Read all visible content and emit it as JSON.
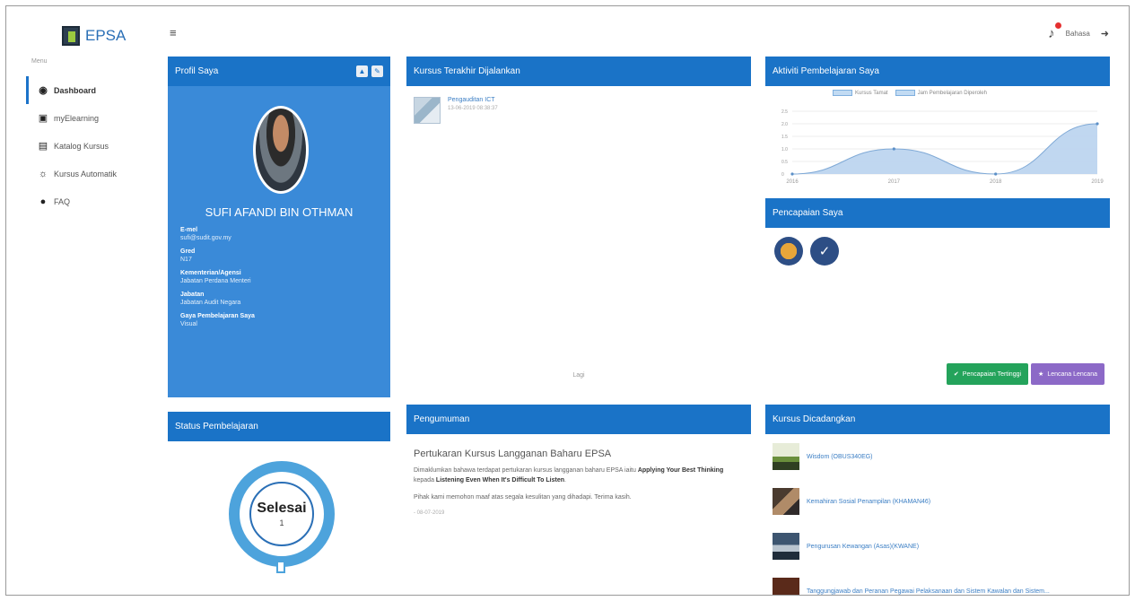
{
  "brand": {
    "name": "EPSA"
  },
  "sidebar": {
    "caption": "Menu",
    "items": [
      {
        "label": "Dashboard",
        "icon": "dashboard-icon",
        "active": true
      },
      {
        "label": "myElearning",
        "icon": "square-icon"
      },
      {
        "label": "Katalog Kursus",
        "icon": "book-icon"
      },
      {
        "label": "Kursus Automatik",
        "icon": "bulb-icon"
      },
      {
        "label": "FAQ",
        "icon": "circle-icon"
      }
    ]
  },
  "topbar": {
    "language_label": "Bahasa",
    "notification_icon": "bell-icon",
    "logout_icon": "signout-icon"
  },
  "profile": {
    "title": "Profil Saya",
    "name": "SUFI AFANDI BIN OTHMAN",
    "fields": [
      {
        "key": "E-mel",
        "value": "sufi@sudit.gov.my"
      },
      {
        "key": "Gred",
        "value": "N17"
      },
      {
        "key": "Kementerian/Agensi",
        "value": "Jabatan Perdana Menteri"
      },
      {
        "key": "Jabatan",
        "value": "Jabatan Audit Negara"
      },
      {
        "key": "Gaya Pembelajaran Saya",
        "value": "Visual"
      }
    ]
  },
  "status": {
    "title": "Status Pembelajaran",
    "label": "Selesai",
    "count": "1"
  },
  "recent": {
    "title": "Kursus Terakhir Dijalankan",
    "course_title": "Pengauditan ICT",
    "course_date": "13-06-2019 08:38:37",
    "more": "Lagi"
  },
  "announcement": {
    "title": "Pengumuman",
    "heading": "Pertukaran Kursus Langganan Baharu EPSA",
    "body_pre": "Dimaklumkan bahawa terdapat pertukaran kursus langganan baharu EPSA iaitu ",
    "bold1": "Applying Your Best Thinking",
    "body_mid": " kepada ",
    "bold2": "Listening Even When It's Difficult To Listen",
    "body_post": ".",
    "sorry": "Pihak kami memohon maaf atas segala kesulitan yang dihadapi. Terima kasih.",
    "date": "- 08-07-2019"
  },
  "activity": {
    "title": "Aktiviti Pembelajaran Saya",
    "legend": [
      "Kursus Tamat",
      "Jam Pembelajaran Diperoleh"
    ]
  },
  "chart_data": {
    "type": "area",
    "x": [
      "2016",
      "2017",
      "2018",
      "2019"
    ],
    "series": [
      {
        "name": "Kursus Tamat",
        "values": [
          0,
          1,
          0,
          2
        ]
      },
      {
        "name": "Jam Pembelajaran Diperoleh",
        "values": [
          0,
          1,
          0,
          2
        ]
      }
    ],
    "yticks": [
      "0",
      "0.5",
      "1.0",
      "1.5",
      "2.0",
      "2.5"
    ],
    "ylim": [
      0,
      2.5
    ]
  },
  "achievement": {
    "title": "Pencapaian Saya",
    "badges": [
      "medal-icon",
      "check-icon"
    ],
    "btn_green": "Pencapaian Tertinggi",
    "btn_purple": "Lencana Lencana"
  },
  "suggest": {
    "title": "Kursus Dicadangkan",
    "items": [
      "Wisdom (OBUS340EG)",
      "Kemahiran Sosial Penampilan (KHAMAN46)",
      "Pengurusan Kewangan (Asas)(KWANE)",
      "Tanggungjawab dan Peranan Pegawai Pelaksanaan dan Sistem Kawalan dan Sistem..."
    ]
  }
}
